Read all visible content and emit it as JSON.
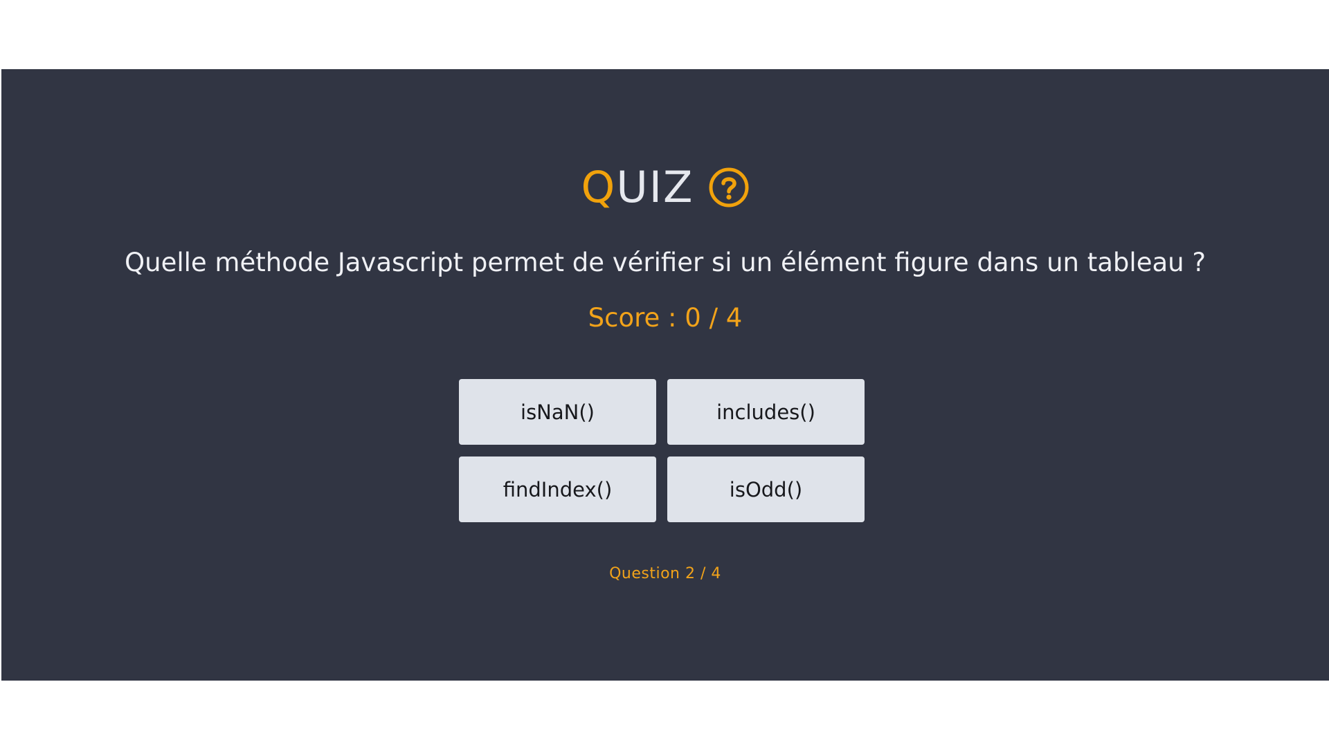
{
  "header": {
    "title_first_letter": "Q",
    "title_rest": "UIZ",
    "icon": "question-circle-icon",
    "accent_color": "#f1a20c"
  },
  "quiz": {
    "question": "Quelle méthode Javascript permet de vérifier si un élément figure dans un tableau ?",
    "score_text": "Score : 0 / 4",
    "answers": [
      {
        "label": "isNaN()"
      },
      {
        "label": "includes()"
      },
      {
        "label": "findIndex()"
      },
      {
        "label": "isOdd()"
      }
    ],
    "progress_text": "Question 2 / 4"
  },
  "colors": {
    "panel_background": "#313543",
    "button_background": "#dfe3ea",
    "accent": "#f2a31a",
    "text_light": "#f0f1f5"
  }
}
